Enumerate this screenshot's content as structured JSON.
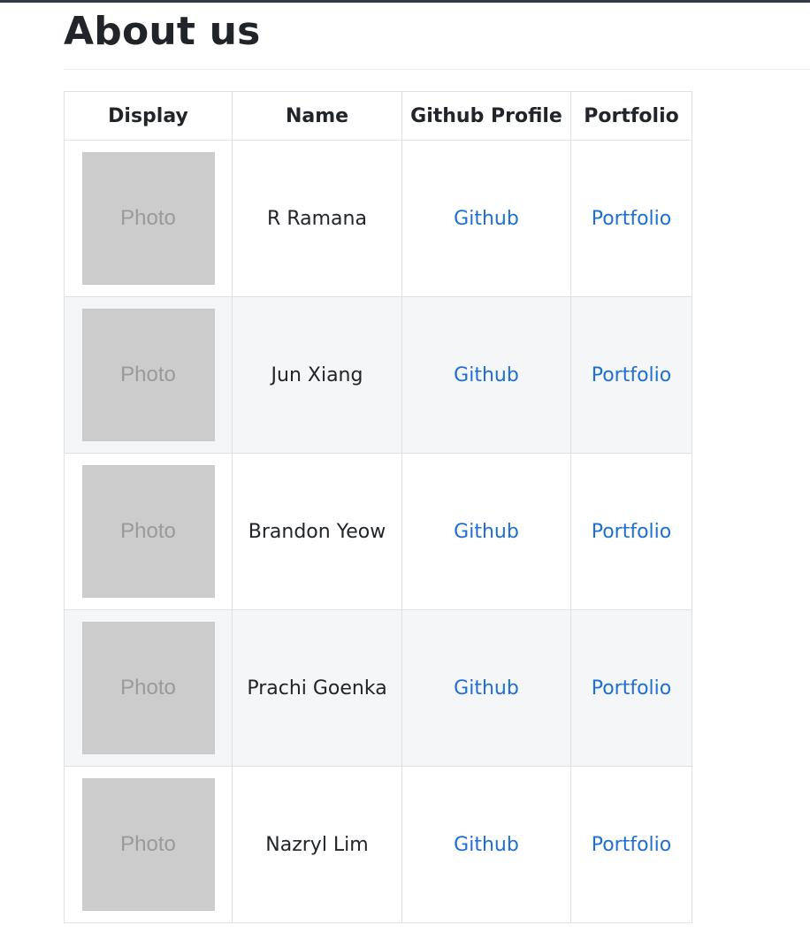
{
  "page": {
    "title": "About us"
  },
  "table": {
    "headers": [
      "Display",
      "Name",
      "Github Profile",
      "Portfolio"
    ],
    "rows": [
      {
        "photo_label": "Photo",
        "name": "R Ramana",
        "github": "Github",
        "portfolio": "Portfolio"
      },
      {
        "photo_label": "Photo",
        "name": "Jun Xiang",
        "github": "Github",
        "portfolio": "Portfolio"
      },
      {
        "photo_label": "Photo",
        "name": "Brandon Yeow",
        "github": "Github",
        "portfolio": "Portfolio"
      },
      {
        "photo_label": "Photo",
        "name": "Prachi Goenka",
        "github": "Github",
        "portfolio": "Portfolio"
      },
      {
        "photo_label": "Photo",
        "name": "Nazryl Lim",
        "github": "Github",
        "portfolio": "Portfolio"
      }
    ]
  },
  "colors": {
    "link": "#1f6fd1",
    "photo_placeholder": "#cccccc",
    "stripe": "#f5f6f8",
    "border": "#dee2e6"
  }
}
